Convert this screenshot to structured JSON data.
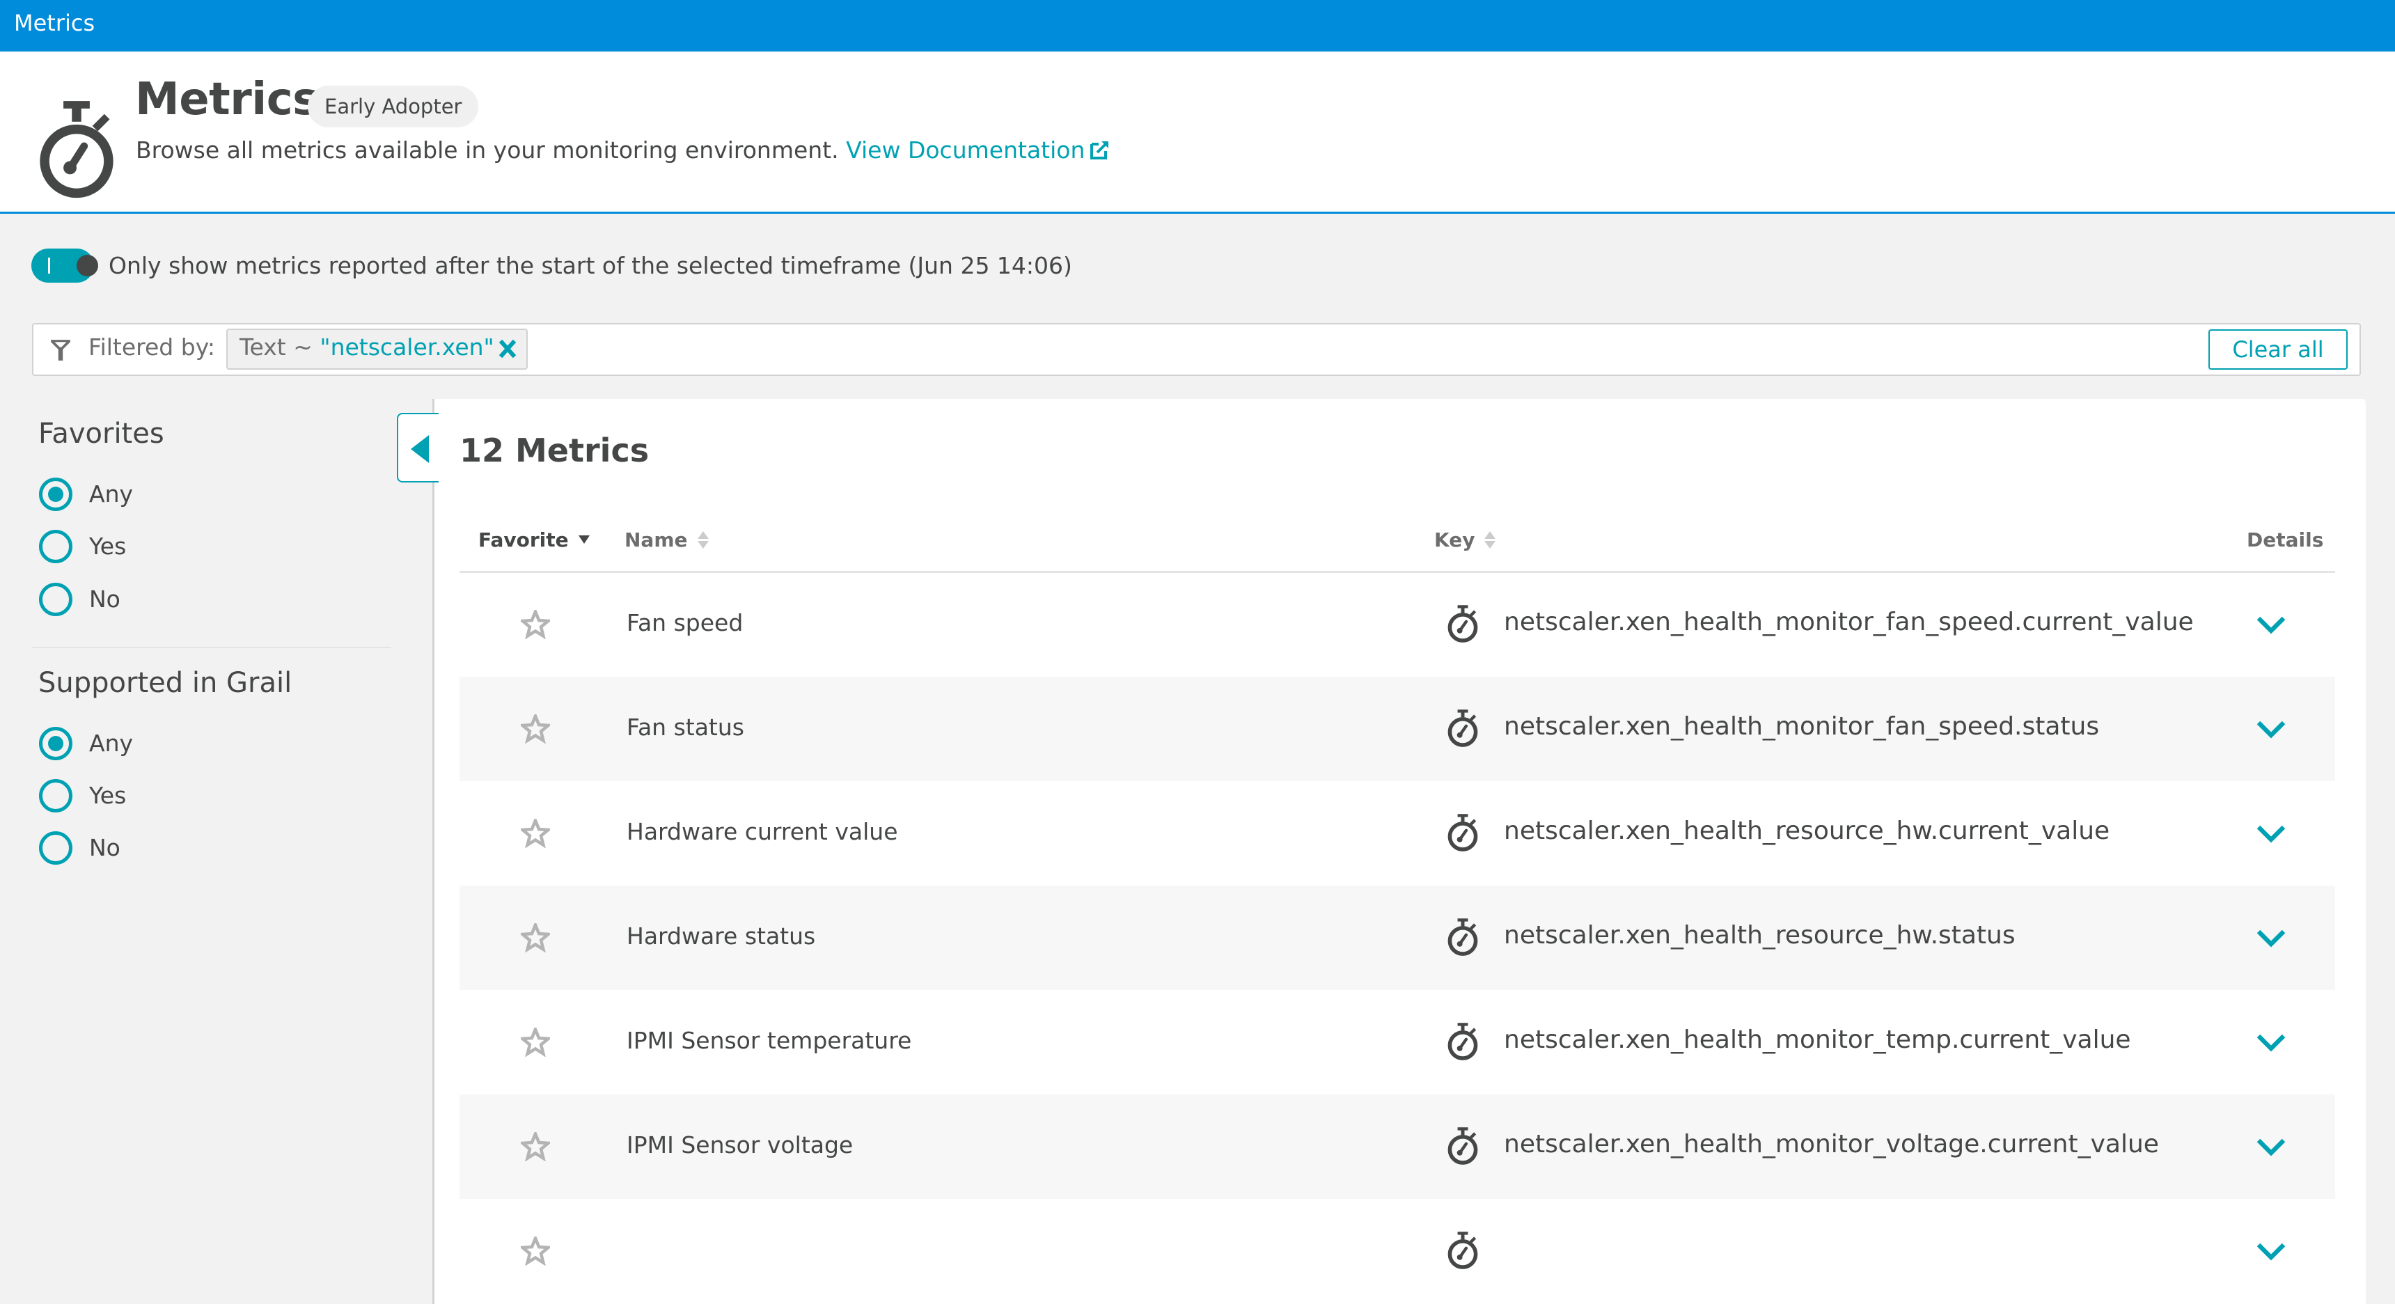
{
  "topbar": {
    "title": "Metrics"
  },
  "header": {
    "title": "Metrics",
    "badge": "Early Adopter",
    "description": "Browse all metrics available in your monitoring environment.",
    "doc_link": "View Documentation"
  },
  "toggle": {
    "on": true,
    "label": "Only show metrics reported after the start of the selected timeframe (Jun 25 14:06)"
  },
  "filter": {
    "label": "Filtered by:",
    "chip": {
      "field": "Text",
      "operator": "~",
      "value": "\"netscaler.xen\""
    },
    "clear_all": "Clear all"
  },
  "sidebar": {
    "groups": [
      {
        "title": "Favorites",
        "options": [
          "Any",
          "Yes",
          "No"
        ],
        "selected": "Any"
      },
      {
        "title": "Supported in Grail",
        "options": [
          "Any",
          "Yes",
          "No"
        ],
        "selected": "Any"
      }
    ]
  },
  "table": {
    "count_label": "12 Metrics",
    "columns": {
      "favorite": "Favorite",
      "name": "Name",
      "key": "Key",
      "details": "Details"
    },
    "sort": {
      "column": "Favorite",
      "direction": "desc"
    },
    "rows": [
      {
        "favorite": false,
        "name": "Fan speed",
        "key": "netscaler.xen_health_monitor_fan_speed.current_value"
      },
      {
        "favorite": false,
        "name": "Fan status",
        "key": "netscaler.xen_health_monitor_fan_speed.status"
      },
      {
        "favorite": false,
        "name": "Hardware current value",
        "key": "netscaler.xen_health_resource_hw.current_value"
      },
      {
        "favorite": false,
        "name": "Hardware status",
        "key": "netscaler.xen_health_resource_hw.status"
      },
      {
        "favorite": false,
        "name": "IPMI Sensor temperature",
        "key": "netscaler.xen_health_monitor_temp.current_value"
      },
      {
        "favorite": false,
        "name": "IPMI Sensor voltage",
        "key": "netscaler.xen_health_monitor_voltage.current_value"
      }
    ]
  },
  "colors": {
    "brand_blue": "#008cdb",
    "accent_teal": "#00a1b2",
    "text": "#454646"
  }
}
